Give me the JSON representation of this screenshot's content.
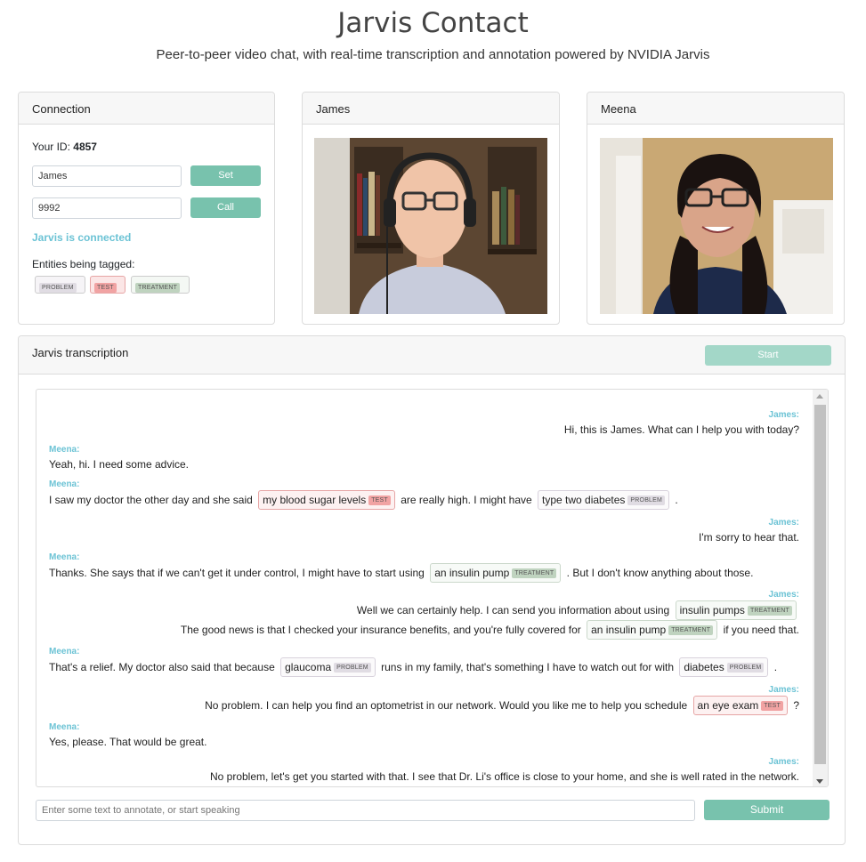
{
  "header": {
    "title": "Jarvis Contact",
    "subtitle": "Peer-to-peer video chat, with real-time transcription and annotation powered by NVIDIA Jarvis"
  },
  "connection": {
    "title": "Connection",
    "your_id_label": "Your ID:",
    "your_id_value": "4857",
    "name_value": "James",
    "set_label": "Set",
    "peer_value": "9992",
    "call_label": "Call",
    "status": "Jarvis is connected",
    "entities_label": "Entities being tagged:",
    "entities": [
      "PROBLEM",
      "TEST",
      "TREATMENT"
    ]
  },
  "video_left": {
    "title": "James"
  },
  "video_right": {
    "title": "Meena"
  },
  "transcription": {
    "title": "Jarvis transcription",
    "start_label": "Start",
    "input_placeholder": "Enter some text to annotate, or start speaking",
    "submit_label": "Submit",
    "messages": [
      {
        "speaker": "James:",
        "side": "right",
        "lines": [
          [
            {
              "t": "Hi, this is James. What can I help you with today?"
            }
          ]
        ]
      },
      {
        "speaker": "Meena:",
        "side": "left",
        "lines": [
          [
            {
              "t": "Yeah, hi. I need some advice."
            }
          ]
        ]
      },
      {
        "speaker": "Meena:",
        "side": "left",
        "lines": [
          [
            {
              "t": "I saw my doctor the other day and she said"
            },
            {
              "e": "my blood sugar levels",
              "tag": "TEST"
            },
            {
              "t": "are really high. I might have"
            },
            {
              "e": "type two diabetes",
              "tag": "PROBLEM"
            },
            {
              "t": "."
            }
          ]
        ]
      },
      {
        "speaker": "James:",
        "side": "right",
        "lines": [
          [
            {
              "t": "I'm sorry to hear that."
            }
          ]
        ]
      },
      {
        "speaker": "Meena:",
        "side": "left",
        "lines": [
          [
            {
              "t": "Thanks. She says that if we can't get it under control, I might have to start using"
            },
            {
              "e": "an insulin pump",
              "tag": "TREATMENT"
            },
            {
              "t": ". But I don't know anything about those."
            }
          ]
        ]
      },
      {
        "speaker": "James:",
        "side": "right",
        "lines": [
          [
            {
              "t": "Well we can certainly help. I can send you information about using"
            },
            {
              "e": "insulin pumps",
              "tag": "TREATMENT"
            }
          ],
          [
            {
              "t": "The good news is that I checked your insurance benefits, and you're fully covered for"
            },
            {
              "e": "an insulin pump",
              "tag": "TREATMENT"
            },
            {
              "t": "if you need that."
            }
          ]
        ]
      },
      {
        "speaker": "Meena:",
        "side": "left",
        "lines": [
          [
            {
              "t": "That's a relief. My doctor also said that because"
            },
            {
              "e": "glaucoma",
              "tag": "PROBLEM"
            },
            {
              "t": "runs in my family, that's something I have to watch out for with"
            },
            {
              "e": "diabetes",
              "tag": "PROBLEM"
            },
            {
              "t": "."
            }
          ]
        ]
      },
      {
        "speaker": "James:",
        "side": "right",
        "lines": [
          [
            {
              "t": "No problem. I can help you find an optometrist in our network. Would you like me to help you schedule"
            },
            {
              "e": "an eye exam",
              "tag": "TEST"
            },
            {
              "t": "?"
            }
          ]
        ]
      },
      {
        "speaker": "Meena:",
        "side": "left",
        "lines": [
          [
            {
              "t": "Yes, please. That would be great."
            }
          ]
        ]
      },
      {
        "speaker": "James:",
        "side": "right",
        "lines": [
          [
            {
              "t": "No problem, let's get you started with that. I see that Dr. Li's office is close to your home, and she is well rated in the network."
            }
          ]
        ]
      }
    ]
  }
}
